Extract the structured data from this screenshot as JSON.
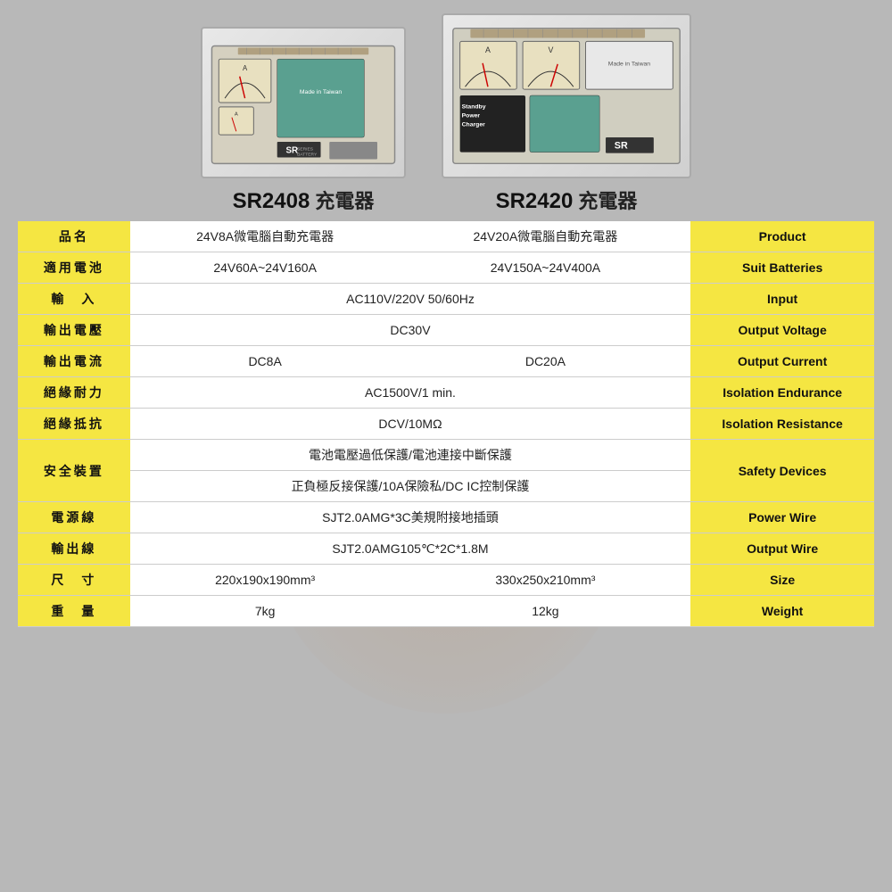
{
  "page": {
    "background": "#b8b8b8"
  },
  "products": [
    {
      "id": "sr2408",
      "model": "SR2408",
      "suffix": " 充電器"
    },
    {
      "id": "sr2420",
      "model": "SR2420",
      "suffix": " 充電器"
    }
  ],
  "table": {
    "rows": [
      {
        "label": "品名",
        "sr2408": "24V8A微電腦自動充電器",
        "sr2420": "24V20A微電腦自動充電器",
        "english": "Product",
        "span": false
      },
      {
        "label": "適用電池",
        "sr2408": "24V60A~24V160A",
        "sr2420": "24V150A~24V400A",
        "english": "Suit Batteries",
        "span": false
      },
      {
        "label": "輸　入",
        "sr2408": "",
        "sr2420": "",
        "span_value": "AC110V/220V  50/60Hz",
        "english": "Input",
        "span": true
      },
      {
        "label": "輸出電壓",
        "sr2408": "",
        "sr2420": "",
        "span_value": "DC30V",
        "english": "Output Voltage",
        "span": true
      },
      {
        "label": "輸出電流",
        "sr2408": "DC8A",
        "sr2420": "DC20A",
        "english": "Output Current",
        "span": false
      },
      {
        "label": "絕緣耐力",
        "sr2408": "",
        "sr2420": "",
        "span_value": "AC1500V/1 min.",
        "english": "Isolation Endurance",
        "span": true
      },
      {
        "label": "絕緣抵抗",
        "sr2408": "",
        "sr2420": "",
        "span_value": "DCV/10MΩ",
        "english": "Isolation Resistance",
        "span": true
      },
      {
        "label": "安全裝置",
        "sr2408": "",
        "sr2420": "",
        "span_value": "電池電壓過低保護/電池連接中斷保護",
        "span_value2": "正負極反接保護/10A保險私/DC  IC控制保護",
        "english": "Safety Devices",
        "span": true,
        "two_lines": true
      },
      {
        "label": "電源線",
        "sr2408": "",
        "sr2420": "",
        "span_value": "SJT2.0AMG*3C美規附接地插頭",
        "english": "Power Wire",
        "span": true
      },
      {
        "label": "輸出線",
        "sr2408": "",
        "sr2420": "",
        "span_value": "SJT2.0AMG105℃*2C*1.8M",
        "english": "Output Wire",
        "span": true
      },
      {
        "label": "尺　寸",
        "sr2408": "220x190x190mm³",
        "sr2420": "330x250x210mm³",
        "english": "Size",
        "span": false
      },
      {
        "label": "重　量",
        "sr2408": "7kg",
        "sr2420": "12kg",
        "english": "Weight",
        "span": false
      }
    ]
  }
}
